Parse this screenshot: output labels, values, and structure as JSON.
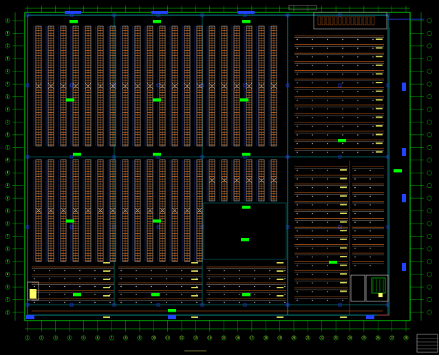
{
  "drawing": {
    "title": "",
    "scale_text": "",
    "background": "#000000",
    "colors": {
      "outline": "#00ff00",
      "rack_frame": "#ffffff",
      "rack_fill": "#ff7a1a",
      "aisle": "#3355ff",
      "wall": "#00c8c8",
      "label": "#ffff66",
      "tag": "#00ff00",
      "pipe": "#ff3030",
      "column": "#2244ff"
    },
    "grid_axis_labels_x": [
      "1",
      "2",
      "3",
      "4",
      "5",
      "6",
      "7",
      "8",
      "9",
      "10",
      "11",
      "12",
      "13",
      "14",
      "15",
      "16",
      "17",
      "18",
      "19",
      "20",
      "21",
      "22",
      "23",
      "24",
      "25",
      "26",
      "27",
      "28"
    ],
    "grid_axis_labels_y": [
      "A",
      "B",
      "C",
      "D",
      "E",
      "F",
      "G",
      "H",
      "J",
      "K",
      "L",
      "M",
      "N",
      "P",
      "Q",
      "R",
      "S",
      "T",
      "U",
      "V",
      "W",
      "X",
      "Y",
      "Z"
    ],
    "zones": [
      {
        "id": "rack-zone-a-upper"
      },
      {
        "id": "rack-zone-b-upper"
      },
      {
        "id": "rack-zone-c-upper"
      },
      {
        "id": "rack-zone-a-lower"
      },
      {
        "id": "rack-zone-b-lower"
      },
      {
        "id": "rack-zone-c-lower"
      },
      {
        "id": "open-storage-area"
      },
      {
        "id": "shelf-zone-east"
      },
      {
        "id": "shelf-zone-south"
      }
    ]
  }
}
